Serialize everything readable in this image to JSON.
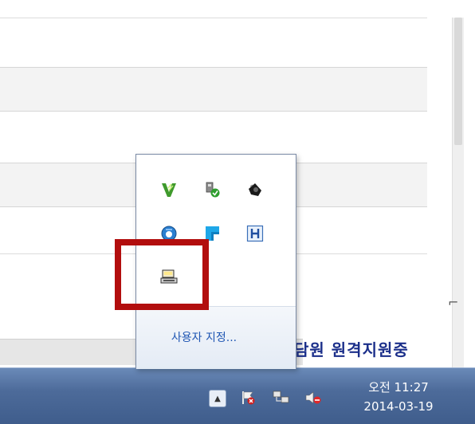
{
  "background": {
    "link_text": "담원 원격지원중"
  },
  "popup": {
    "icons": [
      {
        "name": "vpn-check-icon"
      },
      {
        "name": "usb-safe-remove-icon"
      },
      {
        "name": "black-tray-app-icon"
      },
      {
        "name": "blue-circle-app-icon"
      },
      {
        "name": "blue-flag-app-icon"
      },
      {
        "name": "h-letter-app-icon"
      },
      {
        "name": "highlighted-tray-app-icon"
      }
    ],
    "customize_label": "사용자 지정..."
  },
  "taskbar": {
    "time": "오전 11:27",
    "date": "2014-03-19",
    "tray_icons": [
      "show-hidden-icons-icon",
      "action-center-flag-icon",
      "network-icon",
      "volume-muted-icon"
    ]
  },
  "highlight_color": "#b20e0e"
}
